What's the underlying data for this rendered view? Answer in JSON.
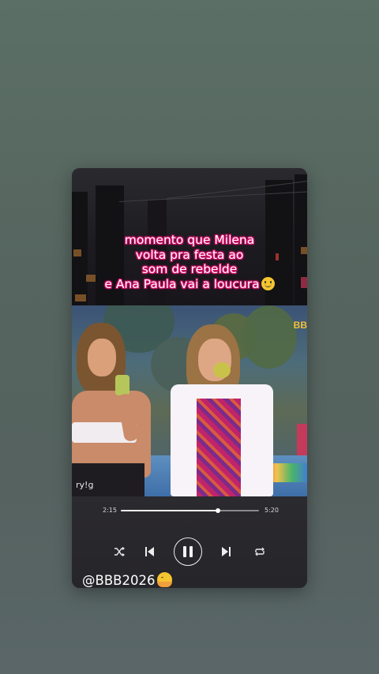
{
  "caption": {
    "line1": "momento que Milena",
    "line2": "volta pra festa ao",
    "line3": "som de rebelde",
    "line4": "e Ana Paula vai a loucura"
  },
  "video": {
    "channel_logo": "BB",
    "watermark": "ry!g"
  },
  "player": {
    "elapsed": "2:15",
    "duration": "5:20",
    "progress_fraction": 0.7,
    "controls": {
      "shuffle_icon": "shuffle-icon",
      "previous_icon": "skip-previous-icon",
      "pause_icon": "pause-icon",
      "next_icon": "skip-next-icon",
      "repeat_icon": "repeat-icon"
    }
  },
  "footer": {
    "handle": "@BBB2026"
  },
  "colors": {
    "caption_outline": "#d4116b",
    "card_bg": "#1c1b1f"
  }
}
